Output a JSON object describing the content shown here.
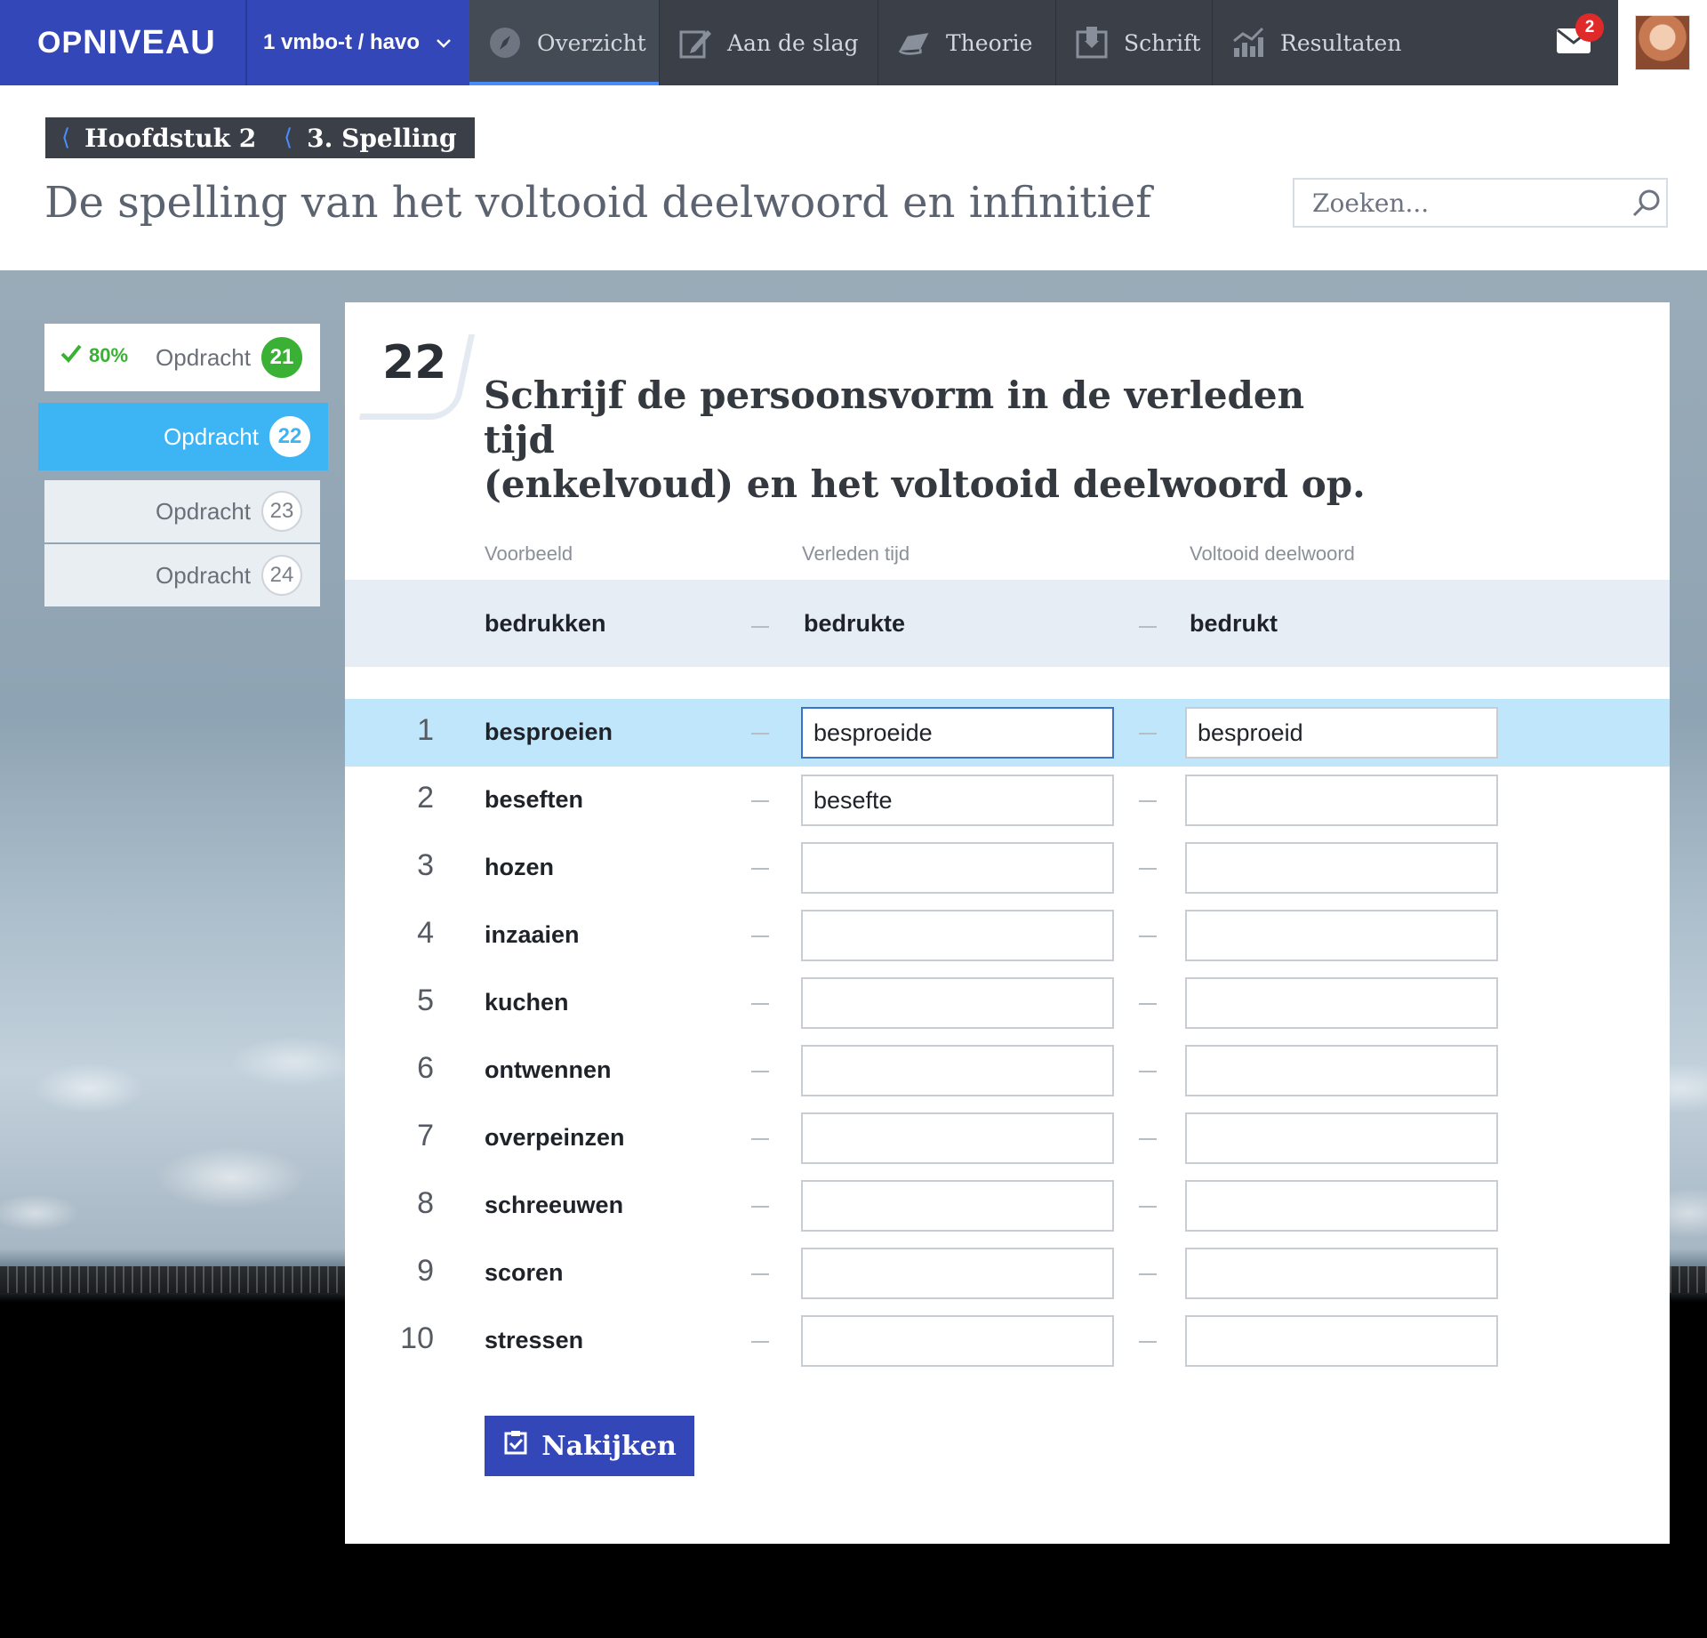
{
  "brand": {
    "logo_op": "OP",
    "logo_niveau": "NIVEAU",
    "accent": "#3447b8",
    "nav_bg": "#3a3f48"
  },
  "level": {
    "label": "1 vmbo-t / havo"
  },
  "nav": {
    "items": [
      {
        "label": "Overzicht",
        "icon": "compass-icon",
        "active": true
      },
      {
        "label": "Aan de slag",
        "icon": "edit-icon",
        "active": false
      },
      {
        "label": "Theorie",
        "icon": "book-icon",
        "active": false
      },
      {
        "label": "Schrift",
        "icon": "notebook-icon",
        "active": false
      },
      {
        "label": "Resultaten",
        "icon": "chart-icon",
        "active": false
      }
    ]
  },
  "mail": {
    "count": "2",
    "icon": "envelope-icon",
    "badge_color": "#e02a2a"
  },
  "breadcrumbs": [
    {
      "label": "Hoofdstuk 2"
    },
    {
      "label": "3. Spelling"
    }
  ],
  "page": {
    "title": "De spelling van het voltooid deelwoord en infinitief"
  },
  "search": {
    "placeholder": "Zoeken..."
  },
  "sidebar": {
    "items": [
      {
        "label": "Opdracht",
        "number": "21",
        "status": "done",
        "score": "80%"
      },
      {
        "label": "Opdracht",
        "number": "22",
        "status": "active"
      },
      {
        "label": "Opdracht",
        "number": "23",
        "status": "muted"
      },
      {
        "label": "Opdracht",
        "number": "24",
        "status": "muted"
      }
    ]
  },
  "task": {
    "number": "22",
    "title_line1": "Schrijf de persoonsvorm in de verleden tijd",
    "title_line2": "(enkelvoud) en het voltooid deelwoord op.",
    "columns": {
      "example": "Voorbeeld",
      "past": "Verleden tijd",
      "participle": "Voltooid deelwoord"
    },
    "example": {
      "word": "bedrukken",
      "past": "bedrukte",
      "participle": "bedrukt"
    },
    "rows": [
      {
        "n": "1",
        "word": "besproeien",
        "past": "besproeide",
        "participle": "besproeid"
      },
      {
        "n": "2",
        "word": "beseften",
        "past": "besefte",
        "participle": ""
      },
      {
        "n": "3",
        "word": "hozen",
        "past": "",
        "participle": ""
      },
      {
        "n": "4",
        "word": "inzaaien",
        "past": "",
        "participle": ""
      },
      {
        "n": "5",
        "word": "kuchen",
        "past": "",
        "participle": ""
      },
      {
        "n": "6",
        "word": "ontwennen",
        "past": "",
        "participle": ""
      },
      {
        "n": "7",
        "word": "overpeinzen",
        "past": "",
        "participle": ""
      },
      {
        "n": "8",
        "word": "schreeuwen",
        "past": "",
        "participle": ""
      },
      {
        "n": "9",
        "word": "scoren",
        "past": "",
        "participle": ""
      },
      {
        "n": "10",
        "word": "stressen",
        "past": "",
        "participle": ""
      }
    ],
    "check_label": "Nakijken"
  }
}
